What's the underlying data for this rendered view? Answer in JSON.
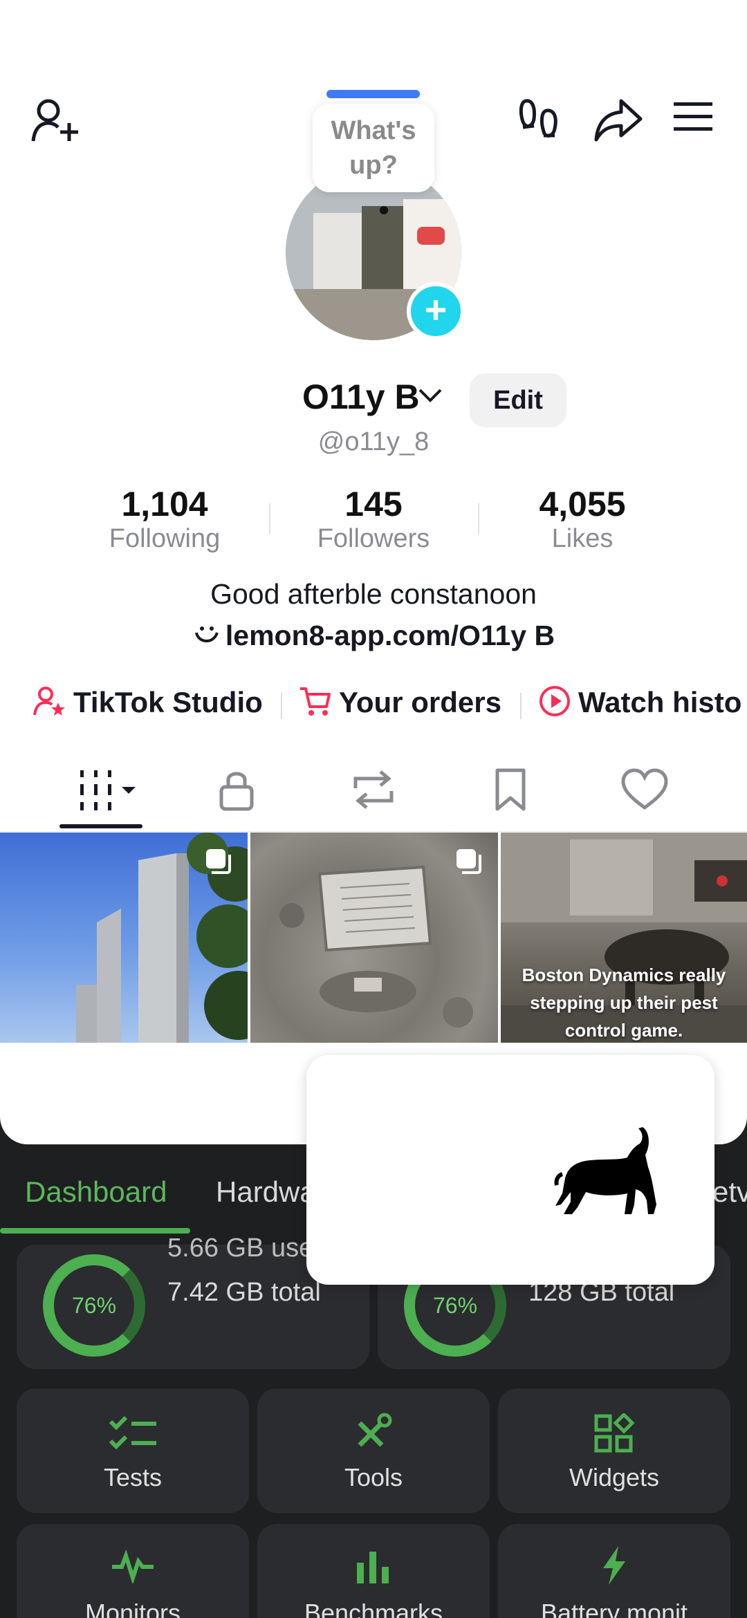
{
  "profile": {
    "whats_up": "What's\nup?",
    "name": "O11y B",
    "edit_label": "Edit",
    "handle": "@o11y_8",
    "stats": [
      {
        "value": "1,104",
        "label": "Following"
      },
      {
        "value": "145",
        "label": "Followers"
      },
      {
        "value": "4,055",
        "label": "Likes"
      }
    ],
    "bio": "Good afterble constanoon",
    "link": "lemon8-app.com/O11y B",
    "shortcuts": [
      {
        "label": "TikTok Studio"
      },
      {
        "label": "Your orders"
      },
      {
        "label": "Watch histo"
      }
    ],
    "videos": [
      {
        "caption": ""
      },
      {
        "caption": ""
      },
      {
        "caption": "Boston Dynamics really stepping up their pest control game."
      }
    ]
  },
  "device_app": {
    "tabs": [
      "Dashboard",
      "Hardwa",
      "etv"
    ],
    "memory": [
      {
        "percent": "76%",
        "used": "5.66 GB use",
        "total": "7.42 GB total"
      },
      {
        "percent": "76%",
        "used": "",
        "total": "128 GB total"
      }
    ],
    "tools": [
      {
        "label": "Tests"
      },
      {
        "label": "Tools"
      },
      {
        "label": "Widgets"
      },
      {
        "label": "Monitors"
      },
      {
        "label": "Benchmarks"
      },
      {
        "label": "Battery monit"
      }
    ]
  },
  "colors": {
    "accent_green": "#4caf50",
    "tiktok_cyan": "#20d5ec",
    "tiktok_red": "#fe2c55",
    "whatsup_bar": "#3d7bf6"
  }
}
